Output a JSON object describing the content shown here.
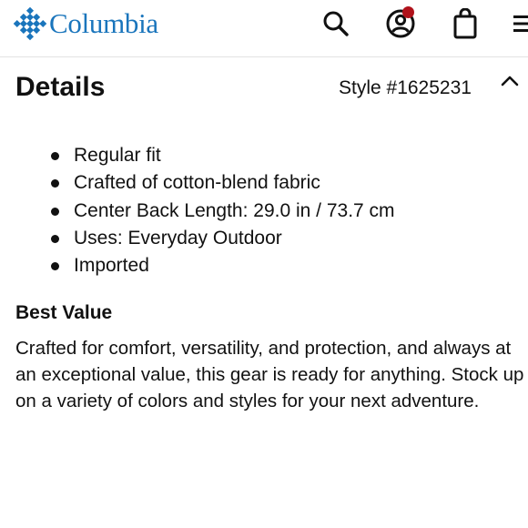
{
  "header": {
    "brand": "Columbia",
    "icons": {
      "search": "search-icon",
      "account": "account-icon",
      "bag": "shopping-bag-icon",
      "menu": "menu-icon"
    },
    "brand_color": "#1a75bc",
    "notification_dot_color": "#b0121b"
  },
  "details": {
    "title": "Details",
    "style_number": "Style #1625231",
    "collapse_icon": "chevron-up-icon",
    "features": [
      "Regular fit",
      "Crafted of cotton-blend fabric",
      "Center Back Length: 29.0 in / 73.7 cm",
      "Uses: Everyday Outdoor",
      "Imported"
    ]
  },
  "best_value": {
    "heading": "Best Value",
    "body": "Crafted for comfort, versatility, and protection, and always at an exceptional value, this gear is ready for anything. Stock up on a variety of colors and styles for your next adventure."
  }
}
